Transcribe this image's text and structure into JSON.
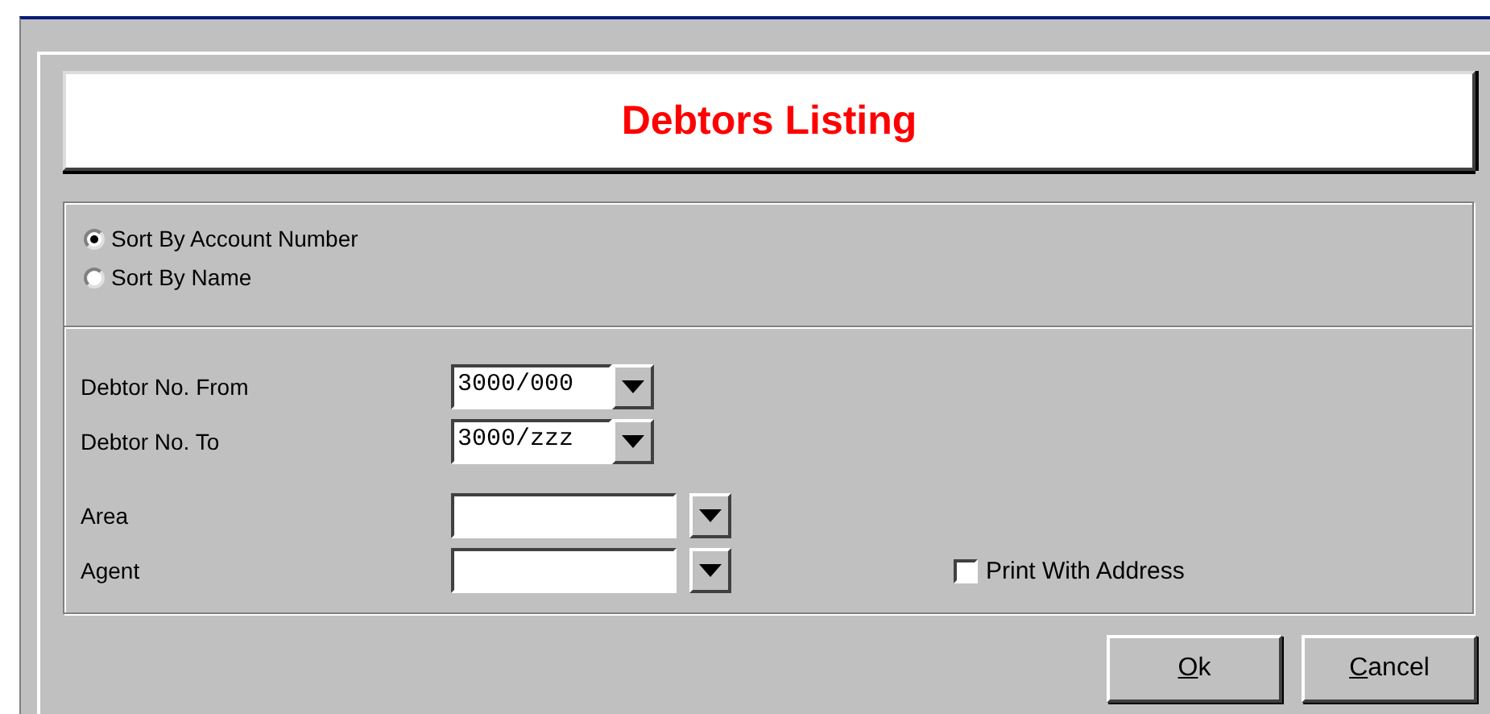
{
  "title": "Debtors Listing",
  "sort_options": [
    {
      "label": "Sort By Account Number",
      "selected": true
    },
    {
      "label": "Sort By Name",
      "selected": false
    }
  ],
  "fields": [
    {
      "label": "Debtor No. From",
      "kind": "code",
      "value": "3000/000"
    },
    {
      "label": "Debtor No. To",
      "kind": "code",
      "value": "3000/zzz"
    },
    {
      "label": "Area",
      "kind": "lookup"
    },
    {
      "label": "Agent",
      "kind": "lookup"
    }
  ],
  "print_with_address": {
    "label": "Print With Address",
    "checked": false
  },
  "buttons": [
    {
      "mnemonic": "O",
      "rest": "k"
    },
    {
      "mnemonic": "C",
      "rest": "ancel"
    }
  ]
}
